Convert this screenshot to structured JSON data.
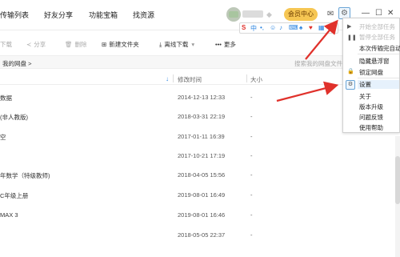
{
  "nav": [
    "传输列表",
    "好友分享",
    "功能宝箱",
    "找资源"
  ],
  "header": {
    "vip_label": "会员中心"
  },
  "window_controls": {
    "min": "—",
    "max": "☐",
    "close": "✕"
  },
  "ime": {
    "label": "中"
  },
  "toolbar": {
    "download": "下载",
    "share": "分享",
    "delete": "删除",
    "new_folder": "新建文件夹",
    "offline": "离线下载",
    "more": "更多"
  },
  "path": {
    "label": "我的网盘 >",
    "search_placeholder": "搜索我的网盘文件"
  },
  "columns": {
    "time": "修改时间",
    "size": "大小"
  },
  "files": [
    {
      "name": "数据",
      "time": "2014-12-13 12:33",
      "size": "-"
    },
    {
      "name": "(非人教版)",
      "time": "2018-03-31 22:19",
      "size": "-"
    },
    {
      "name": "空",
      "time": "2017-01-11 16:39",
      "size": "-"
    },
    {
      "name": "",
      "time": "2017-10-21 17:19",
      "size": "-"
    },
    {
      "name": "年数学（特级教师)",
      "time": "2018-04-05 15:56",
      "size": "-"
    },
    {
      "name": "C年级上册",
      "time": "2019-08-01 16:49",
      "size": "-"
    },
    {
      "name": "MAX 3",
      "time": "2019-08-01 16:46",
      "size": "-"
    },
    {
      "name": "",
      "time": "2018-05-05 22:37",
      "size": "-"
    }
  ],
  "menu": {
    "items": [
      {
        "label": "开始全部任务",
        "disabled": true
      },
      {
        "label": "暂停全部任务",
        "disabled": true
      },
      {
        "label": "本次传输完自动",
        "disabled": false
      },
      {
        "label": "隐藏悬浮窗",
        "disabled": false
      },
      {
        "label": "锁定网盘",
        "disabled": false
      },
      {
        "label": "设置",
        "disabled": false
      },
      {
        "label": "关于",
        "disabled": false
      },
      {
        "label": "版本升级",
        "disabled": false
      },
      {
        "label": "问题反馈",
        "disabled": false
      },
      {
        "label": "使用帮助",
        "disabled": false
      }
    ]
  },
  "colors": {
    "accent": "#2a84e0",
    "vip": "#f6c653",
    "arrow": "#e0312b"
  }
}
